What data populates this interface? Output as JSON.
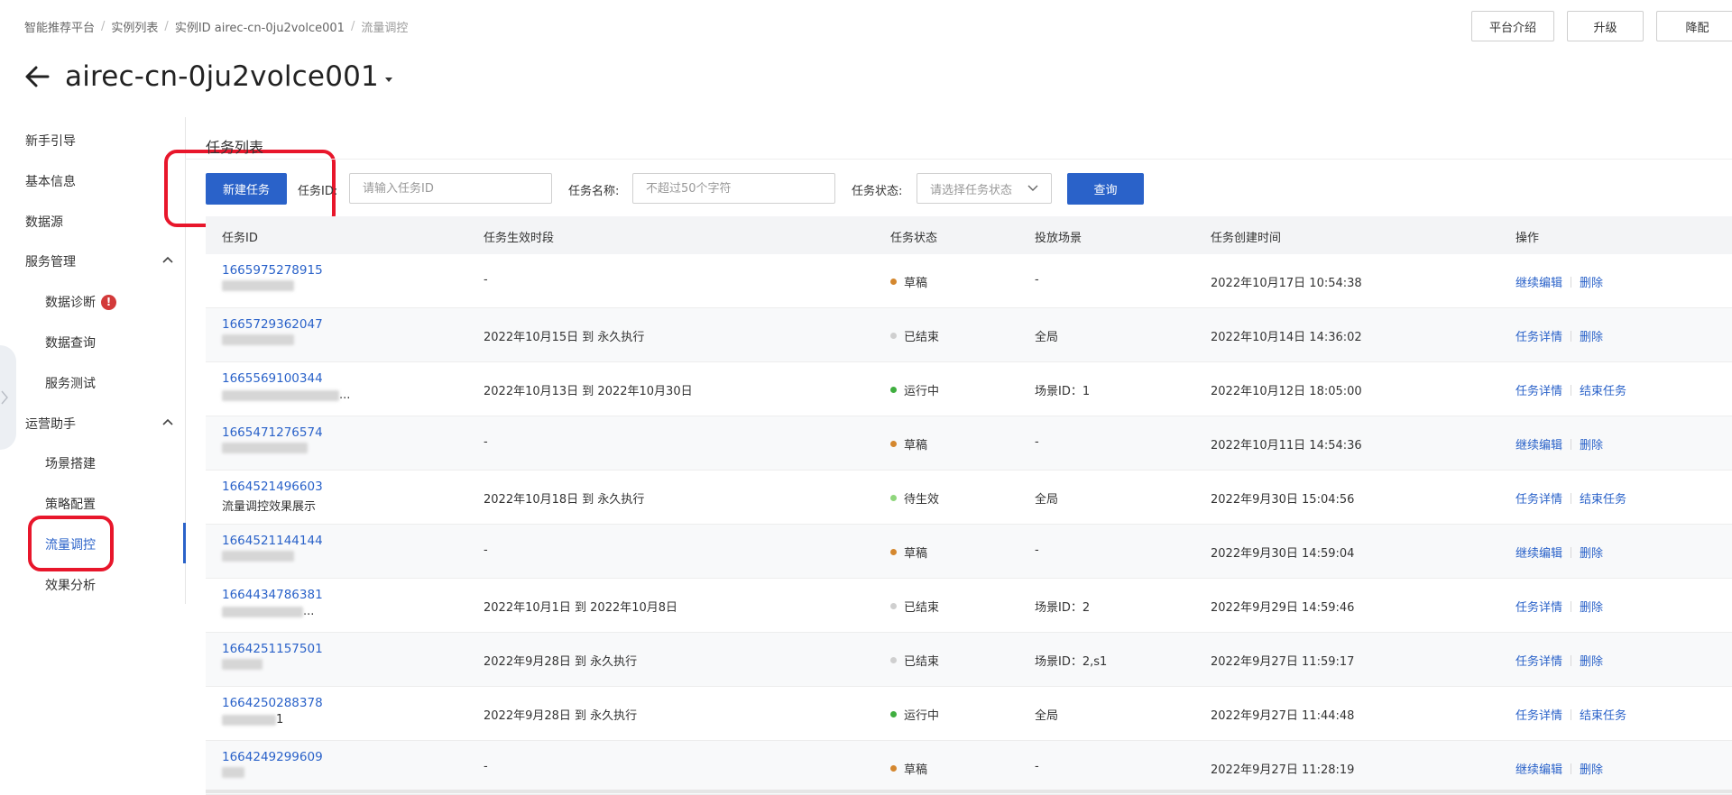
{
  "breadcrumb": [
    "智能推荐平台",
    "实例列表",
    "实例ID airec-cn-0ju2volce001",
    "流量调控"
  ],
  "header_buttons": [
    "平台介绍",
    "升级",
    "降配"
  ],
  "page_title": "airec-cn-0ju2volce001",
  "sidebar": {
    "items": [
      {
        "label": "新手引导"
      },
      {
        "label": "基本信息"
      },
      {
        "label": "数据源"
      },
      {
        "label": "服务管理"
      },
      {
        "label": "数据诊断",
        "badge": "!"
      },
      {
        "label": "数据查询"
      },
      {
        "label": "服务测试"
      },
      {
        "label": "运营助手"
      },
      {
        "label": "场景搭建"
      },
      {
        "label": "策略配置"
      },
      {
        "label": "流量调控"
      },
      {
        "label": "效果分析"
      }
    ],
    "active": "流量调控"
  },
  "content": {
    "title": "任务列表",
    "new_task_button": "新建任务",
    "filters": {
      "task_id_label": "任务ID:",
      "task_id_placeholder": "请输入任务ID",
      "task_name_label": "任务名称:",
      "task_name_placeholder": "不超过50个字符",
      "task_status_label": "任务状态:",
      "task_status_placeholder": "请选择任务状态",
      "query_button": "查询"
    },
    "columns": [
      "任务ID",
      "任务生效时段",
      "任务状态",
      "投放场景",
      "任务创建时间",
      "操作"
    ],
    "rows": [
      {
        "id": "1665975278915",
        "name": "",
        "period": "-",
        "status": "草稿",
        "scene": "-",
        "created": "2022年10月17日 10:54:38",
        "ops": [
          "继续编辑",
          "删除"
        ]
      },
      {
        "id": "1665729362047",
        "name": "",
        "period": "2022年10月15日 到 永久执行",
        "status": "已结束",
        "scene": "全局",
        "created": "2022年10月14日 14:36:02",
        "ops": [
          "任务详情",
          "删除"
        ]
      },
      {
        "id": "1665569100344",
        "name": "...",
        "period": "2022年10月13日 到 2022年10月30日",
        "status": "运行中",
        "scene": "场景ID：1",
        "created": "2022年10月12日 18:05:00",
        "ops": [
          "任务详情",
          "结束任务"
        ]
      },
      {
        "id": "1665471276574",
        "name": "",
        "period": "-",
        "status": "草稿",
        "scene": "-",
        "created": "2022年10月11日 14:54:36",
        "ops": [
          "继续编辑",
          "删除"
        ]
      },
      {
        "id": "1664521496603",
        "name": "流量调控效果展示",
        "period": "2022年10月18日 到 永久执行",
        "status": "待生效",
        "scene": "全局",
        "created": "2022年9月30日 15:04:56",
        "ops": [
          "任务详情",
          "结束任务"
        ]
      },
      {
        "id": "1664521144144",
        "name": "",
        "period": "-",
        "status": "草稿",
        "scene": "-",
        "created": "2022年9月30日 14:59:04",
        "ops": [
          "继续编辑",
          "删除"
        ]
      },
      {
        "id": "1664434786381",
        "name": "...",
        "period": "2022年10月1日 到 2022年10月8日",
        "status": "已结束",
        "scene": "场景ID：2",
        "created": "2022年9月29日 14:59:46",
        "ops": [
          "任务详情",
          "删除"
        ]
      },
      {
        "id": "1664251157501",
        "name": "",
        "period": "2022年9月28日 到 永久执行",
        "status": "已结束",
        "scene": "场景ID：2,s1",
        "created": "2022年9月27日 11:59:17",
        "ops": [
          "任务详情",
          "删除"
        ]
      },
      {
        "id": "1664250288378",
        "name": "1",
        "period": "2022年9月28日 到 永久执行",
        "status": "运行中",
        "scene": "全局",
        "created": "2022年9月27日 11:44:48",
        "ops": [
          "任务详情",
          "结束任务"
        ]
      },
      {
        "id": "1664249299609",
        "name": "",
        "period": "-",
        "status": "草稿",
        "scene": "-",
        "created": "2022年9月27日 11:28:19",
        "ops": [
          "继续编辑",
          "删除"
        ]
      }
    ]
  },
  "status_colors": {
    "草稿": "#d4872e",
    "已结束": "#cfcfcf",
    "运行中": "#3fae3f",
    "待生效": "#8fd67c"
  },
  "colors": {
    "primary": "#2a62c9",
    "highlight": "#e8162b",
    "alert": "#d33a3a"
  }
}
